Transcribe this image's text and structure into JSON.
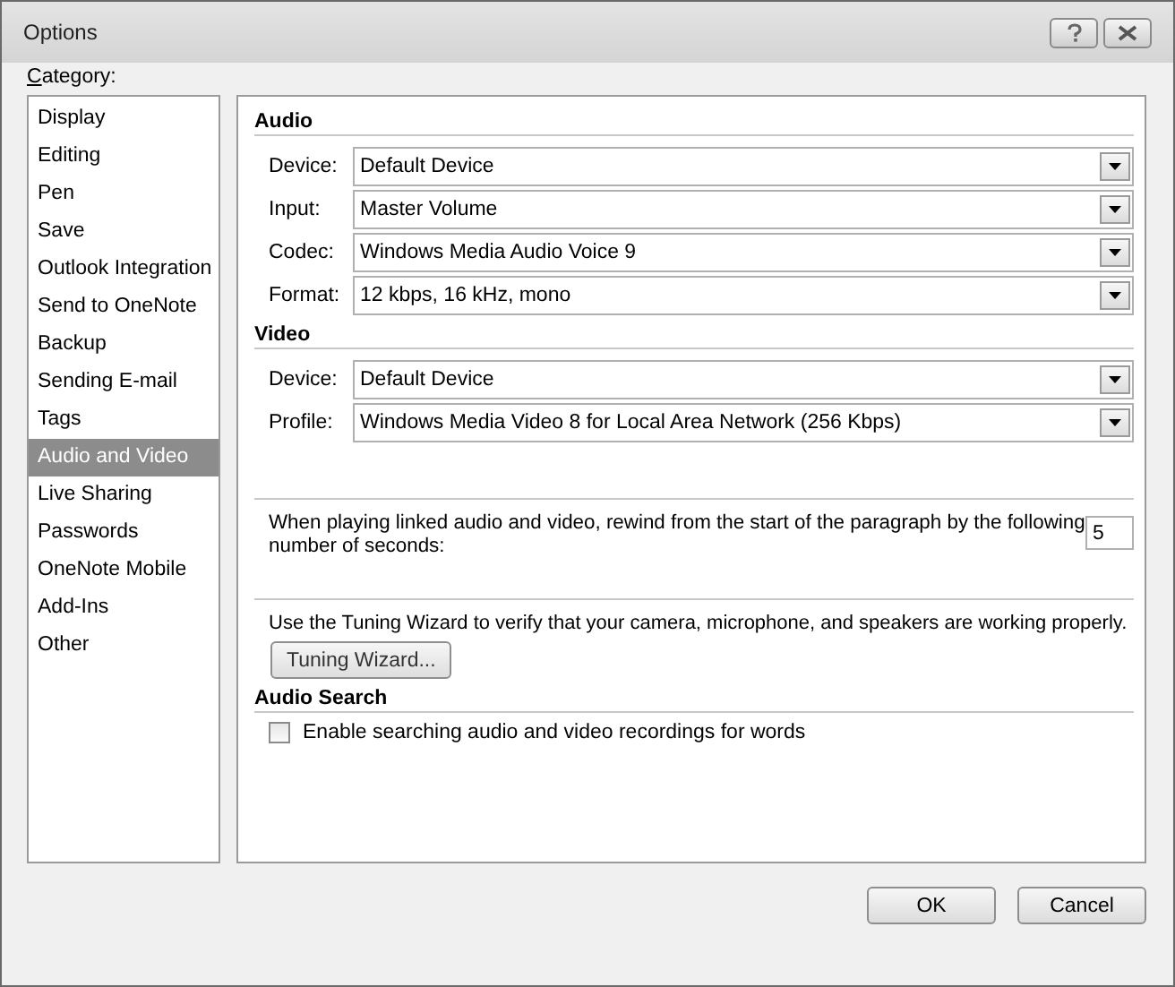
{
  "window": {
    "title": "Options"
  },
  "category_label": "Category:",
  "sidebar": {
    "items": [
      {
        "label": "Display",
        "selected": false
      },
      {
        "label": "Editing",
        "selected": false
      },
      {
        "label": "Pen",
        "selected": false
      },
      {
        "label": "Save",
        "selected": false
      },
      {
        "label": "Outlook Integration",
        "selected": false
      },
      {
        "label": "Send to OneNote",
        "selected": false
      },
      {
        "label": "Backup",
        "selected": false
      },
      {
        "label": "Sending E-mail",
        "selected": false
      },
      {
        "label": "Tags",
        "selected": false
      },
      {
        "label": "Audio and Video",
        "selected": true
      },
      {
        "label": "Live Sharing",
        "selected": false
      },
      {
        "label": "Passwords",
        "selected": false
      },
      {
        "label": "OneNote Mobile",
        "selected": false
      },
      {
        "label": "Add-Ins",
        "selected": false
      },
      {
        "label": "Other",
        "selected": false
      }
    ]
  },
  "audio": {
    "heading": "Audio",
    "fields": [
      {
        "label": "Device:",
        "value": "Default Device"
      },
      {
        "label": "Input:",
        "value": "Master Volume"
      },
      {
        "label": "Codec:",
        "value": "Windows Media Audio Voice 9"
      },
      {
        "label": "Format:",
        "value": "12 kbps, 16 kHz, mono"
      }
    ]
  },
  "video": {
    "heading": "Video",
    "fields": [
      {
        "label": "Device:",
        "value": "Default Device"
      },
      {
        "label": "Profile:",
        "value": "Windows Media Video 8 for Local Area Network (256 Kbps)"
      }
    ]
  },
  "rewind": {
    "text": "When playing linked audio and video, rewind from the start of the paragraph by the following number of seconds:",
    "value": "5"
  },
  "tuning": {
    "text": "Use the Tuning Wizard to verify that your camera, microphone, and speakers are working properly.",
    "button": "Tuning Wizard..."
  },
  "audio_search": {
    "heading": "Audio Search",
    "checkbox": {
      "label": "Enable searching audio and video recordings for words",
      "checked": false
    }
  },
  "buttons": [
    "OK",
    "Cancel"
  ]
}
